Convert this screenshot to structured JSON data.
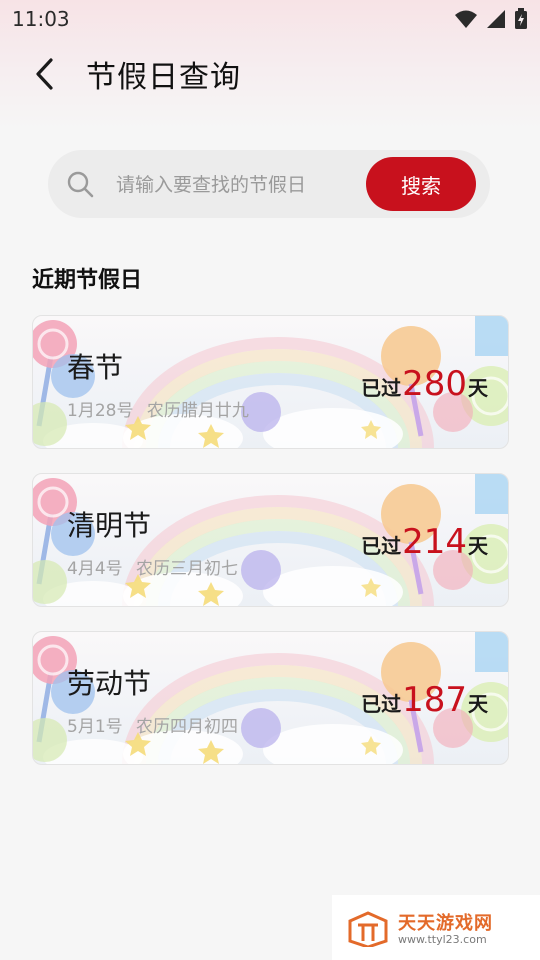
{
  "status_bar": {
    "time": "11:03",
    "icons": [
      "wifi-icon",
      "signal-icon",
      "battery-charging-icon"
    ]
  },
  "header": {
    "back_icon": "chevron-left-icon",
    "title": "节假日查询"
  },
  "search": {
    "icon": "search-icon",
    "placeholder": "请输入要查找的节假日",
    "value": "",
    "button_label": "搜索"
  },
  "section": {
    "title": "近期节假日"
  },
  "holidays": [
    {
      "name": "春节",
      "date": "1月28号",
      "lunar": "农历腊月廿九",
      "prefix": "已过",
      "days": "280",
      "suffix": "天"
    },
    {
      "name": "清明节",
      "date": "4月4号",
      "lunar": "农历三月初七",
      "prefix": "已过",
      "days": "214",
      "suffix": "天"
    },
    {
      "name": "劳动节",
      "date": "5月1号",
      "lunar": "农历四月初四",
      "prefix": "已过",
      "days": "187",
      "suffix": "天"
    }
  ],
  "watermark": {
    "name": "天天游戏网",
    "url": "www.ttyl23.com"
  },
  "colors": {
    "accent": "#c8111d",
    "background": "#f6f6f6"
  }
}
